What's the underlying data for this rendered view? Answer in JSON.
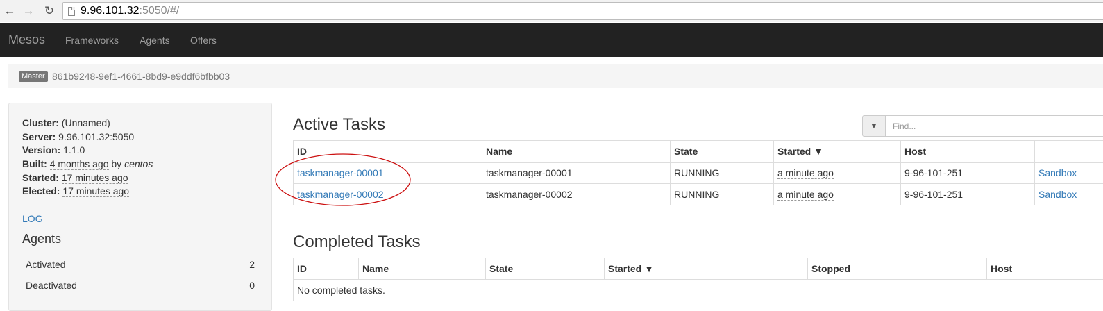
{
  "browser": {
    "url_host": "9.96.101.32",
    "url_rest": ":5050/#/"
  },
  "navbar": {
    "brand": "Mesos",
    "links": [
      "Frameworks",
      "Agents",
      "Offers"
    ]
  },
  "breadcrumb": {
    "badge": "Master",
    "id": "861b9248-9ef1-4661-8bd9-e9ddf6bfbb03"
  },
  "cluster_info": {
    "cluster_label": "Cluster:",
    "cluster_value": "(Unnamed)",
    "server_label": "Server:",
    "server_value": "9.96.101.32:5050",
    "version_label": "Version:",
    "version_value": "1.1.0",
    "built_label": "Built:",
    "built_value": "4 months ago",
    "built_by": "by",
    "built_user": "centos",
    "started_label": "Started:",
    "started_value": "17 minutes ago",
    "elected_label": "Elected:",
    "elected_value": "17 minutes ago",
    "log_link": "LOG"
  },
  "agents": {
    "title": "Agents",
    "rows": [
      {
        "label": "Activated",
        "value": "2"
      },
      {
        "label": "Deactivated",
        "value": "0"
      }
    ]
  },
  "active_tasks": {
    "title": "Active Tasks",
    "filter_placeholder": "Find...",
    "columns": [
      "ID",
      "Name",
      "State",
      "Started ▼",
      "Host",
      ""
    ],
    "rows": [
      {
        "id": "taskmanager-00001",
        "name": "taskmanager-00001",
        "state": "RUNNING",
        "started": "a minute ago",
        "host": "9-96-101-251",
        "action": "Sandbox"
      },
      {
        "id": "taskmanager-00002",
        "name": "taskmanager-00002",
        "state": "RUNNING",
        "started": "a minute ago",
        "host": "9-96-101-251",
        "action": "Sandbox"
      }
    ]
  },
  "completed_tasks": {
    "title": "Completed Tasks",
    "columns": [
      "ID",
      "Name",
      "State",
      "Started ▼",
      "Stopped",
      "Host"
    ],
    "empty_text": "No completed tasks."
  },
  "colors": {
    "navbar_bg": "#222222",
    "link": "#337ab7",
    "annotation": "#cc1111"
  }
}
